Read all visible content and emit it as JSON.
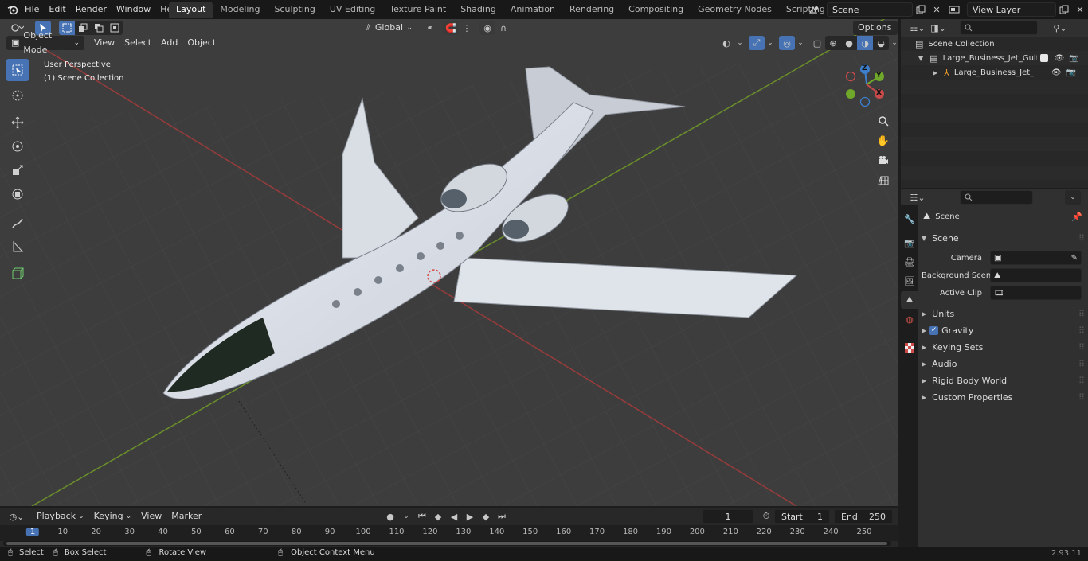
{
  "app": {
    "menus": [
      "File",
      "Edit",
      "Render",
      "Window",
      "Help"
    ],
    "workspaces": [
      "Layout",
      "Modeling",
      "Sculpting",
      "UV Editing",
      "Texture Paint",
      "Shading",
      "Animation",
      "Rendering",
      "Compositing",
      "Geometry Nodes",
      "Scripting"
    ],
    "active_workspace": "Layout",
    "scene_name": "Scene",
    "view_layer": "View Layer"
  },
  "viewport": {
    "mode": "Object Mode",
    "menus": [
      "View",
      "Select",
      "Add",
      "Object"
    ],
    "transform_orientation": "Global",
    "options_label": "Options",
    "overlay_title": "User Perspective",
    "overlay_subtitle": "(1) Scene Collection",
    "gizmo_axes": {
      "x": "X",
      "y": "Y",
      "z": "Z"
    }
  },
  "outliner": {
    "root": "Scene Collection",
    "items": [
      {
        "label": "Large_Business_Jet_Gulfstrea",
        "level": 1
      },
      {
        "label": "Large_Business_Jet_Gulfs",
        "level": 2
      }
    ]
  },
  "properties": {
    "header": "Scene",
    "section": "Scene",
    "fields": [
      {
        "label": "Camera"
      },
      {
        "label": "Background Scene"
      },
      {
        "label": "Active Clip"
      }
    ],
    "panels": [
      "Units",
      "Gravity",
      "Keying Sets",
      "Audio",
      "Rigid Body World",
      "Custom Properties"
    ]
  },
  "timeline": {
    "menus": [
      "Playback",
      "Keying",
      "View",
      "Marker"
    ],
    "current_frame": "1",
    "start_label": "Start",
    "start": "1",
    "end_label": "End",
    "end": "250",
    "ruler": [
      "1",
      "10",
      "20",
      "30",
      "40",
      "50",
      "60",
      "70",
      "80",
      "90",
      "100",
      "110",
      "120",
      "130",
      "140",
      "150",
      "160",
      "170",
      "180",
      "190",
      "200",
      "210",
      "220",
      "230",
      "240",
      "250"
    ]
  },
  "statusbar": {
    "select": "Select",
    "box_select": "Box Select",
    "rotate_view": "Rotate View",
    "context_menu": "Object Context Menu",
    "version": "2.93.11"
  },
  "colors": {
    "accent": "#4772b3",
    "x_axis": "#c84a4a",
    "y_axis": "#6fa82a",
    "z_axis": "#3d7fcc"
  }
}
